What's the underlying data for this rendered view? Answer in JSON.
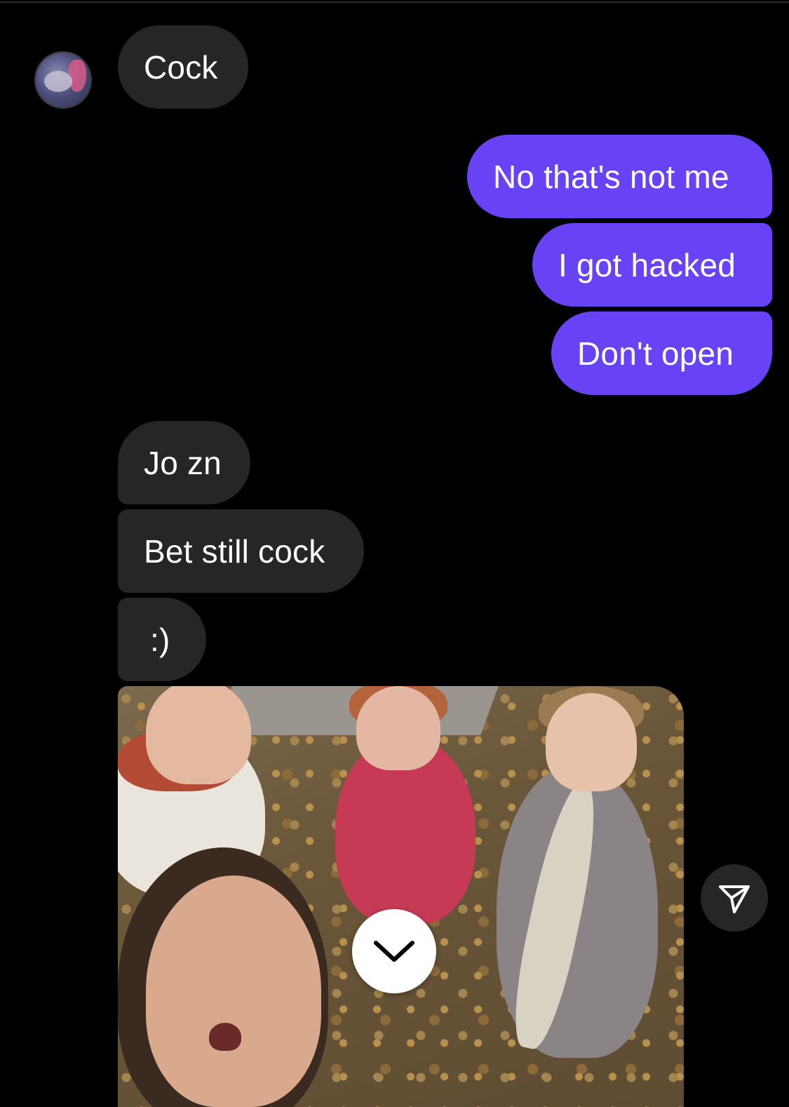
{
  "colors": {
    "background": "#000000",
    "incoming_bubble": "#262626",
    "outgoing_bubble": "#6843f5",
    "text": "#ffffff"
  },
  "messages": [
    {
      "direction": "incoming",
      "text": "Cock"
    },
    {
      "direction": "outgoing",
      "text": "No that's not me"
    },
    {
      "direction": "outgoing",
      "text": "I got hacked"
    },
    {
      "direction": "outgoing",
      "text": "Don't open"
    },
    {
      "direction": "incoming",
      "text": "Jo zn"
    },
    {
      "direction": "incoming",
      "text": "Bet still cock"
    },
    {
      "direction": "incoming",
      "text": ":)"
    }
  ],
  "icons": {
    "scroll_down": "chevron-down-icon",
    "share": "paper-plane-icon"
  }
}
